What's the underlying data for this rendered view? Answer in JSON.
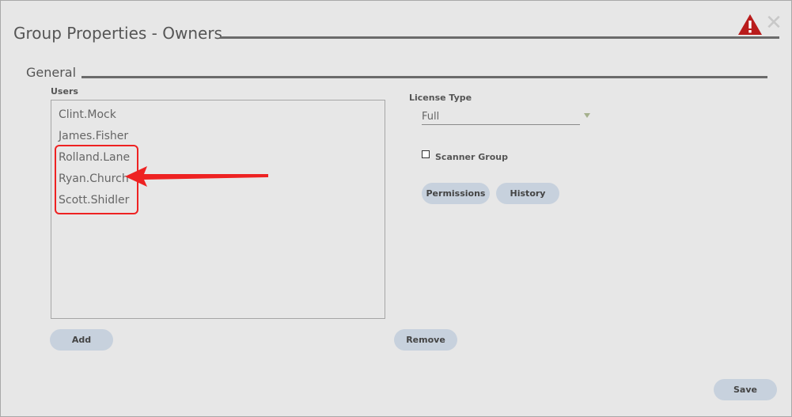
{
  "dialog": {
    "title": "Group Properties - Owners",
    "close_glyph": "✕",
    "icons": [
      "warning-icon",
      "close-icon"
    ]
  },
  "general": {
    "section_title": "General",
    "users_label": "Users",
    "users": [
      "Clint.Mock",
      "James.Fisher",
      "Rolland.Lane",
      "Ryan.Church",
      "Scott.Shidler"
    ],
    "license_label": "License Type",
    "license_value": "Full",
    "scanner_group_label": "Scanner Group",
    "scanner_group_checked": false,
    "permissions_label": "Permissions",
    "history_label": "History"
  },
  "actions": {
    "add_label": "Add",
    "remove_label": "Remove",
    "save_label": "Save"
  },
  "colors": {
    "background": "#e7e7e7",
    "rule": "#6b6b6b",
    "button": "#c7d1dd",
    "annotation": "#ee2222",
    "warning": "#b91c1c"
  }
}
